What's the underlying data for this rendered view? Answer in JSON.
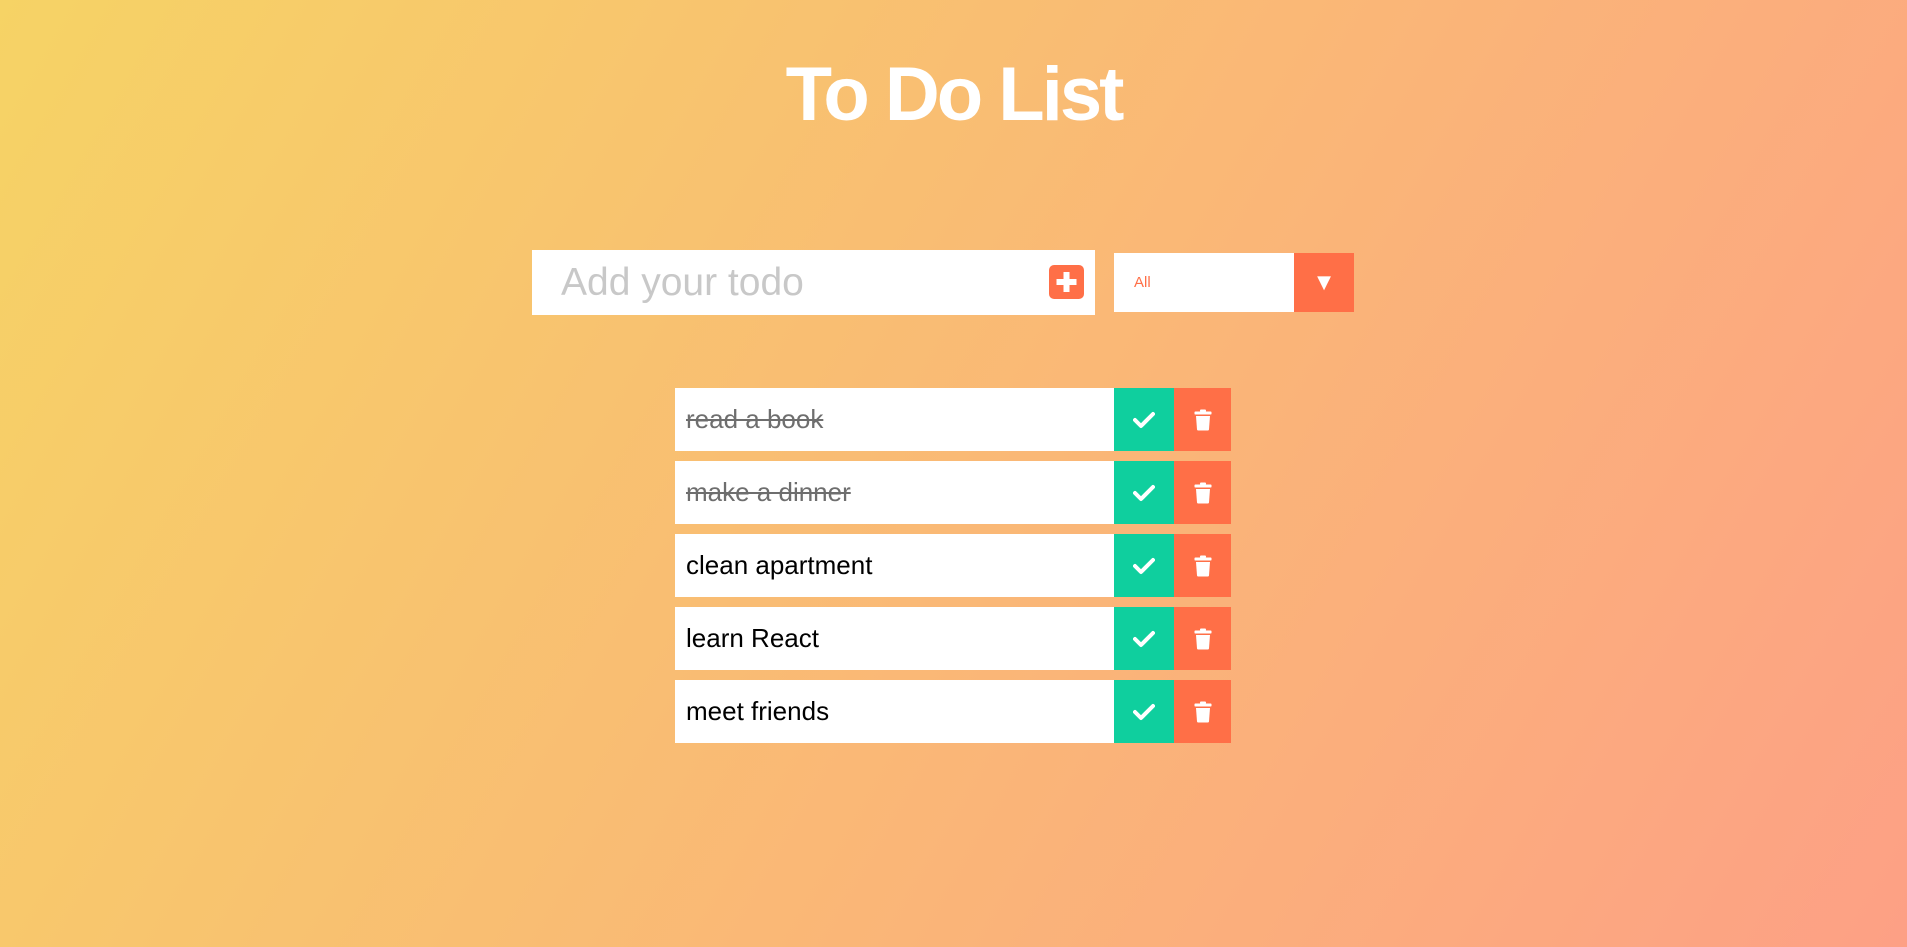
{
  "app": {
    "title": "To Do List"
  },
  "form": {
    "input_placeholder": "Add your todo",
    "input_value": "",
    "add_icon": "plus-square-icon"
  },
  "filter": {
    "selected": "All",
    "arrow_glyph": "▼"
  },
  "todos": [
    {
      "text": "read a book",
      "completed": true
    },
    {
      "text": "make a dinner",
      "completed": true
    },
    {
      "text": "clean apartment",
      "completed": false
    },
    {
      "text": "learn React",
      "completed": false
    },
    {
      "text": "meet friends",
      "completed": false
    }
  ],
  "icons": {
    "complete": "check-icon",
    "delete": "trash-icon"
  },
  "colors": {
    "gradient_start": "#f6d365",
    "gradient_end": "#fda085",
    "accent": "#ff6f47",
    "complete": "#0fcf9e",
    "surface": "#ffffff"
  }
}
